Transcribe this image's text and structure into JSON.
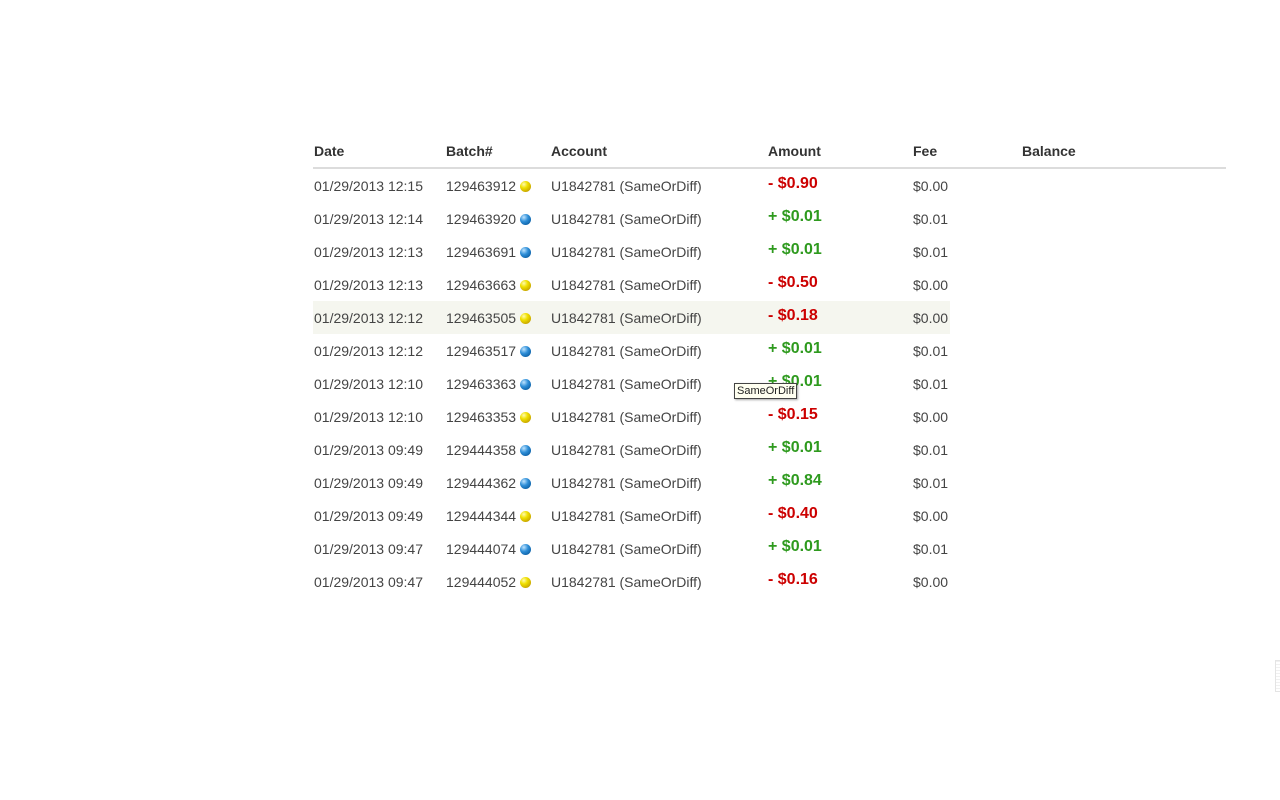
{
  "table": {
    "headers": {
      "date": "Date",
      "batch": "Batch#",
      "account": "Account",
      "amount": "Amount",
      "fee": "Fee",
      "balance": "Balance"
    },
    "rows": [
      {
        "date": "01/29/2013 12:15",
        "batch": "129463912",
        "status_icon": "yellow-dot-icon",
        "account": "U1842781 (SameOrDiff)",
        "amount": "- $0.90",
        "direction": "out",
        "fee": "$0.00",
        "balance": ""
      },
      {
        "date": "01/29/2013 12:14",
        "batch": "129463920",
        "status_icon": "blue-dot-icon",
        "account": "U1842781 (SameOrDiff)",
        "amount": "+ $0.01",
        "direction": "in",
        "fee": "$0.01",
        "balance": ""
      },
      {
        "date": "01/29/2013 12:13",
        "batch": "129463691",
        "status_icon": "blue-dot-icon",
        "account": "U1842781 (SameOrDiff)",
        "amount": "+ $0.01",
        "direction": "in",
        "fee": "$0.01",
        "balance": ""
      },
      {
        "date": "01/29/2013 12:13",
        "batch": "129463663",
        "status_icon": "yellow-dot-icon",
        "account": "U1842781 (SameOrDiff)",
        "amount": "- $0.50",
        "direction": "out",
        "fee": "$0.00",
        "balance": ""
      },
      {
        "date": "01/29/2013 12:12",
        "batch": "129463505",
        "status_icon": "yellow-dot-icon",
        "account": "U1842781 (SameOrDiff)",
        "amount": "- $0.18",
        "direction": "out",
        "fee": "$0.00",
        "balance": "",
        "hovered": true
      },
      {
        "date": "01/29/2013 12:12",
        "batch": "129463517",
        "status_icon": "blue-dot-icon",
        "account": "U1842781 (SameOrDiff)",
        "amount": "+ $0.01",
        "direction": "in",
        "fee": "$0.01",
        "balance": ""
      },
      {
        "date": "01/29/2013 12:10",
        "batch": "129463363",
        "status_icon": "blue-dot-icon",
        "account": "U1842781 (SameOrDiff)",
        "amount": "+ $0.01",
        "direction": "in",
        "fee": "$0.01",
        "balance": ""
      },
      {
        "date": "01/29/2013 12:10",
        "batch": "129463353",
        "status_icon": "yellow-dot-icon",
        "account": "U1842781 (SameOrDiff)",
        "amount": "- $0.15",
        "direction": "out",
        "fee": "$0.00",
        "balance": ""
      },
      {
        "date": "01/29/2013 09:49",
        "batch": "129444358",
        "status_icon": "blue-dot-icon",
        "account": "U1842781 (SameOrDiff)",
        "amount": "+ $0.01",
        "direction": "in",
        "fee": "$0.01",
        "balance": ""
      },
      {
        "date": "01/29/2013 09:49",
        "batch": "129444362",
        "status_icon": "blue-dot-icon",
        "account": "U1842781 (SameOrDiff)",
        "amount": "+ $0.84",
        "direction": "in",
        "fee": "$0.01",
        "balance": ""
      },
      {
        "date": "01/29/2013 09:49",
        "batch": "129444344",
        "status_icon": "yellow-dot-icon",
        "account": "U1842781 (SameOrDiff)",
        "amount": "- $0.40",
        "direction": "out",
        "fee": "$0.00",
        "balance": ""
      },
      {
        "date": "01/29/2013 09:47",
        "batch": "129444074",
        "status_icon": "blue-dot-icon",
        "account": "U1842781 (SameOrDiff)",
        "amount": "+ $0.01",
        "direction": "in",
        "fee": "$0.01",
        "balance": ""
      },
      {
        "date": "01/29/2013 09:47",
        "batch": "129444052",
        "status_icon": "yellow-dot-icon",
        "account": "U1842781 (SameOrDiff)",
        "amount": "- $0.16",
        "direction": "out",
        "fee": "$0.00",
        "balance": ""
      }
    ]
  },
  "tooltip": {
    "text": "SameOrDiff"
  },
  "colors": {
    "amount_in": "#2e9a1e",
    "amount_out": "#cc0000",
    "hover_row": "#f5f6ef",
    "status_yellow": "#e6d300",
    "status_blue": "#1f7cc4"
  }
}
